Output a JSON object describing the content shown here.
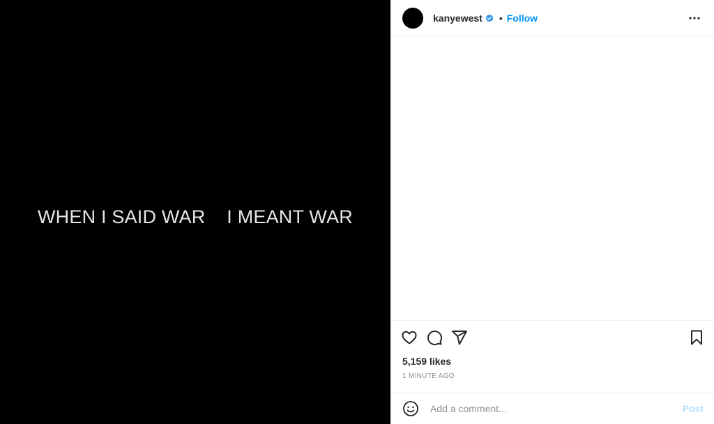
{
  "media": {
    "caption_text": "WHEN I SAID WAR    I MEANT WAR"
  },
  "header": {
    "username": "kanyewest",
    "separator": "•",
    "follow_label": "Follow"
  },
  "icons": {
    "avatar": "avatar",
    "verified": "verified-badge-icon",
    "more": "more-options-icon",
    "like": "heart-icon",
    "comment": "comment-icon",
    "share": "share-icon",
    "save": "bookmark-icon",
    "emoji": "emoji-icon"
  },
  "stats": {
    "likes": "5,159 likes",
    "time": "1 MINUTE AGO"
  },
  "comment_bar": {
    "placeholder": "Add a comment...",
    "value": "",
    "post_label": "Post"
  },
  "colors": {
    "accent": "#0095f6",
    "post_disabled": "#b2dffc",
    "media_bg": "#000000"
  }
}
